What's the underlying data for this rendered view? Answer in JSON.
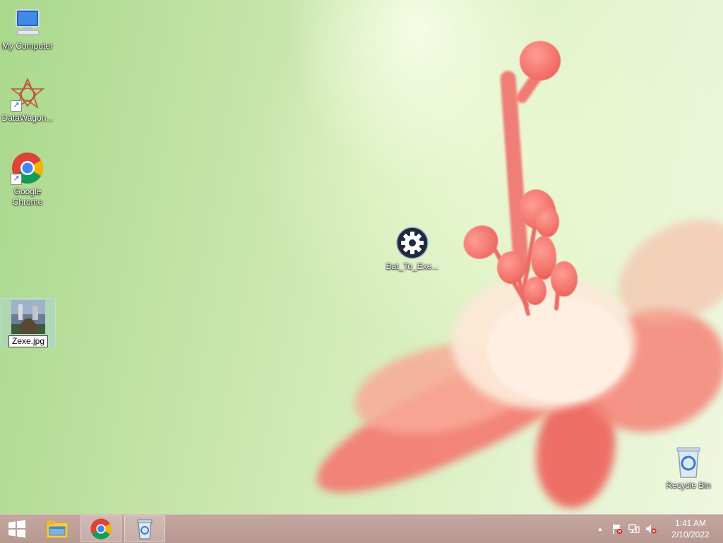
{
  "desktop": {
    "icons": [
      {
        "label": "My Computer",
        "icon": "computer-icon"
      },
      {
        "label": "DataWagon...",
        "icon": "datawagon-icon"
      },
      {
        "label": "Google Chrome",
        "icon": "chrome-icon"
      },
      {
        "label": "Zexe.jpg",
        "icon": "image-file-icon"
      },
      {
        "label": "Bat_To_Exe...",
        "icon": "gear-icon"
      },
      {
        "label": "Recycle Bin",
        "icon": "recycle-bin-icon"
      }
    ]
  },
  "taskbar": {
    "start": "windows-start-icon",
    "pinned": [
      "file-explorer-icon",
      "chrome-icon",
      "recycle-bin-icon"
    ],
    "tray": {
      "show_hidden": "▲",
      "time": "1:41 AM",
      "date": "2/10/2022"
    }
  }
}
